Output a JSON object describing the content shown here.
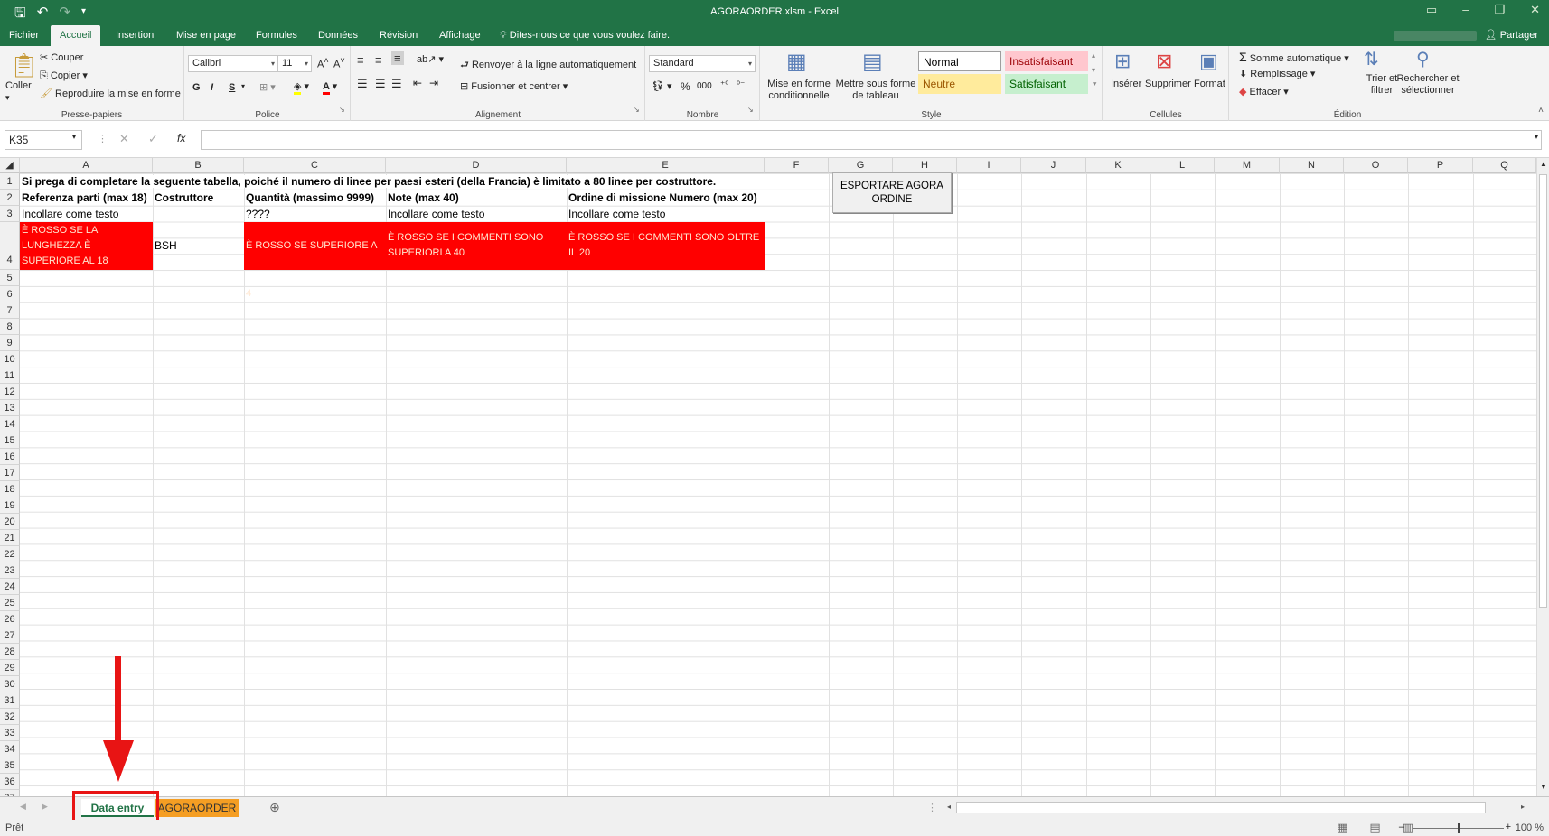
{
  "window": {
    "title": "AGORAORDER.xlsm - Excel",
    "qat_icons": [
      "save-icon",
      "undo-icon",
      "redo-icon",
      "customize-icon"
    ]
  },
  "tabs": [
    "Fichier",
    "Accueil",
    "Insertion",
    "Mise en page",
    "Formules",
    "Données",
    "Révision",
    "Affichage"
  ],
  "tellme": "Dites-nous ce que vous voulez faire.",
  "share": "Partager",
  "ribbon": {
    "clipboard": {
      "paste": "Coller",
      "cut": "Couper",
      "copy": "Copier",
      "painter": "Reproduire la mise en forme",
      "label": "Presse-papiers"
    },
    "font": {
      "name": "Calibri",
      "size": "11",
      "label": "Police",
      "bold": "G",
      "italic": "I",
      "underline": "S"
    },
    "alignment": {
      "wrap": "Renvoyer à la ligne automatiquement",
      "merge": "Fusionner et centrer",
      "label": "Alignement"
    },
    "number": {
      "format": "Standard",
      "pct": "%",
      "thousands": "000",
      "label": "Nombre"
    },
    "styles": {
      "cond": "Mise en forme conditionnelle",
      "table": "Mettre sous forme de tableau",
      "normal": "Normal",
      "bad": "Insatisfaisant",
      "neutral": "Neutre",
      "good": "Satisfaisant",
      "label": "Style"
    },
    "cells": {
      "insert": "Insérer",
      "delete": "Supprimer",
      "format": "Format",
      "label": "Cellules"
    },
    "editing": {
      "autosum": "Somme automatique",
      "fill": "Remplissage",
      "clear": "Effacer",
      "sort": "Trier et filtrer",
      "find": "Rechercher et sélectionner",
      "label": "Édition"
    }
  },
  "formula_bar": {
    "namebox": "K35",
    "fx": "fx",
    "value": ""
  },
  "columns": [
    "A",
    "B",
    "C",
    "D",
    "E",
    "F",
    "G",
    "H",
    "I",
    "J",
    "K",
    "L",
    "M",
    "N",
    "O",
    "P",
    "Q"
  ],
  "rows": [
    "1",
    "2",
    "3",
    "4",
    "5",
    "6",
    "7",
    "8",
    "9",
    "10",
    "11",
    "12",
    "13",
    "14",
    "15",
    "16",
    "17",
    "18",
    "19",
    "20",
    "21",
    "22",
    "23",
    "24",
    "25",
    "26",
    "27",
    "28",
    "29",
    "30",
    "31",
    "32",
    "33",
    "34",
    "35",
    "36",
    "37"
  ],
  "cells": {
    "r1": "Si prega di completare la seguente tabella, poiché il numero di linee per paesi esteri (della Francia) è limitato a 80 linee per costruttore.",
    "a2": "Referenza parti (max 18)",
    "b2": "Costruttore",
    "c2": "Quantità  (massimo 9999)",
    "d2": "Note  (max 40)",
    "e2": "Ordine di missione Numero  (max 20)",
    "a3": "Incollare come testo",
    "c3": "????",
    "d3": "Incollare come testo",
    "e3": "Incollare come testo",
    "a4": "È ROSSO SE LA LUNGHEZZA È SUPERIORE AL 18",
    "b4": "BSH",
    "c4": "È ROSSO SE SUPERIORE A 4",
    "d4": "È ROSSO SE I COMMENTI SONO SUPERIORI A 40",
    "e4": "È ROSSO SE I COMMENTI SONO OLTRE IL 20"
  },
  "export_button": "ESPORTARE AGORA ORDINE",
  "sheets": [
    "Data entry",
    "AGORAORDER"
  ],
  "status": {
    "ready": "Prêt",
    "zoom": "100 %"
  },
  "colors": {
    "excel_green": "#217346",
    "red_fill": "#ff0000",
    "agora_tab": "#f59e23",
    "annotation_red": "#e81414"
  }
}
